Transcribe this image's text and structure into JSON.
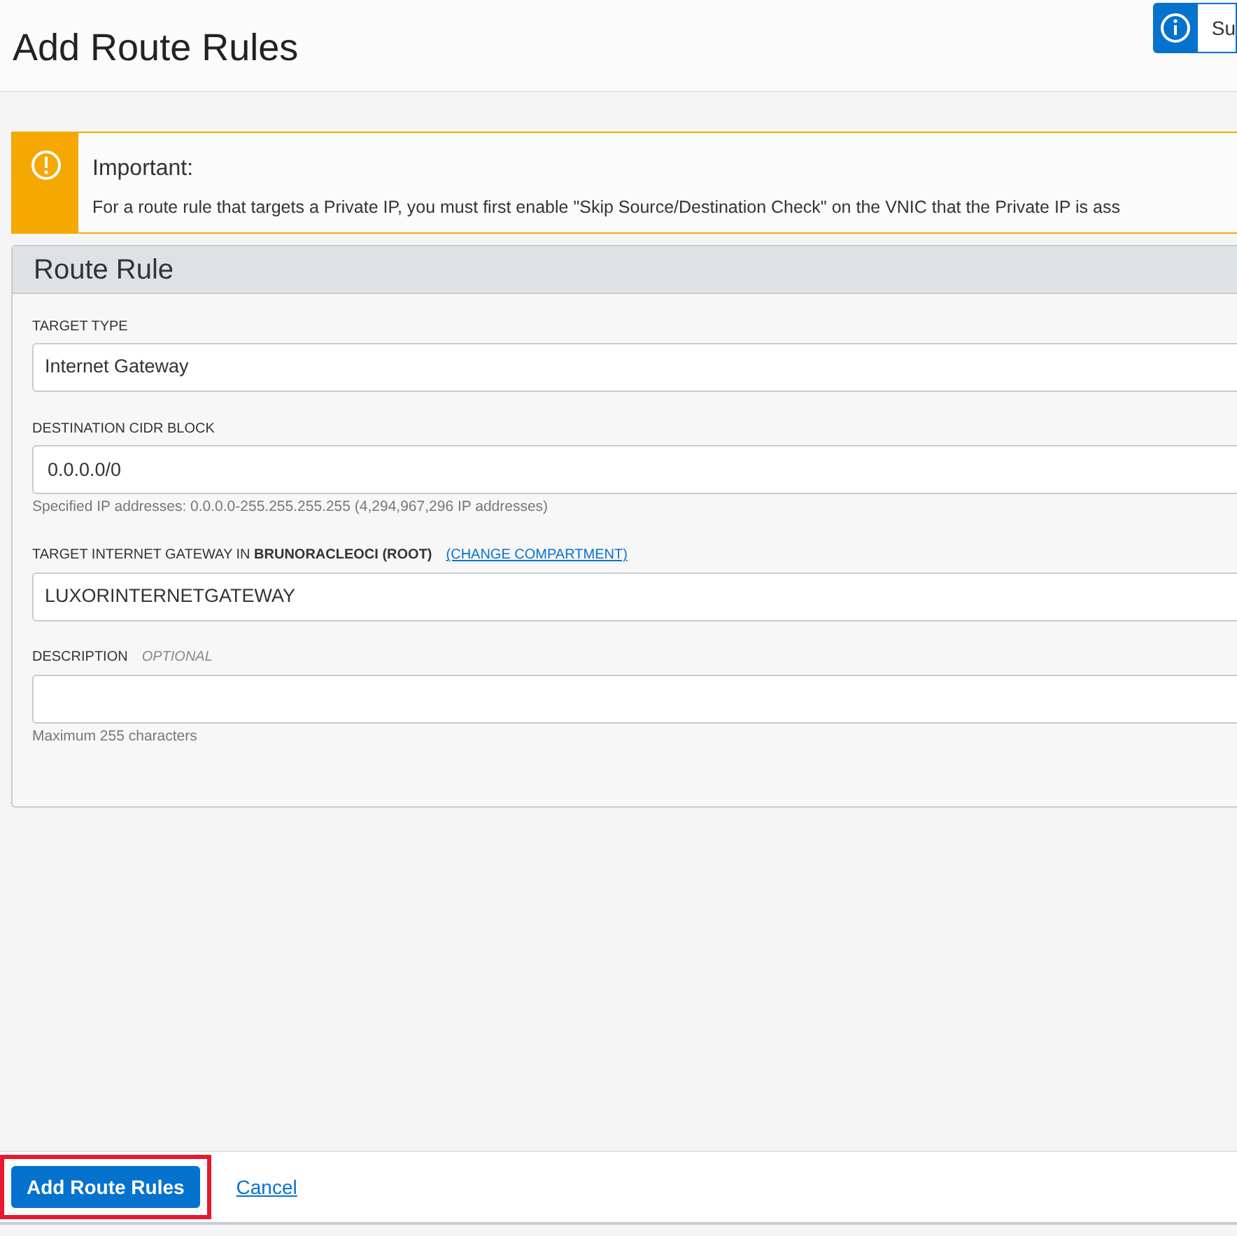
{
  "header": {
    "title": "Add Route Rules",
    "info_button": "Su"
  },
  "alert": {
    "title": "Important:",
    "message": "For a route rule that targets a Private IP, you must first enable \"Skip Source/Destination Check\" on the VNIC that the Private IP is ass"
  },
  "panel": {
    "title": "Route Rule",
    "fields": [
      {
        "kind": "select",
        "label": "TARGET TYPE",
        "value": "Internet Gateway"
      },
      {
        "kind": "input",
        "label": "DESTINATION CIDR BLOCK",
        "value": "0.0.0.0/0",
        "help": "Specified IP addresses: 0.0.0.0-255.255.255.255 (4,294,967,296 IP addresses)"
      },
      {
        "kind": "select",
        "label": "TARGET INTERNET GATEWAY IN **BRUNORACLEOCI (ROOT)**",
        "link": "(CHANGE COMPARTMENT)",
        "value": "LUXORINTERNETGATEWAY"
      },
      {
        "kind": "input",
        "label": "DESCRIPTION",
        "optional": "OPTIONAL",
        "help": "Maximum 255 characters"
      }
    ]
  },
  "footer": {
    "primary": "Add Route Rules",
    "cancel": "Cancel",
    "highlighted": true
  }
}
